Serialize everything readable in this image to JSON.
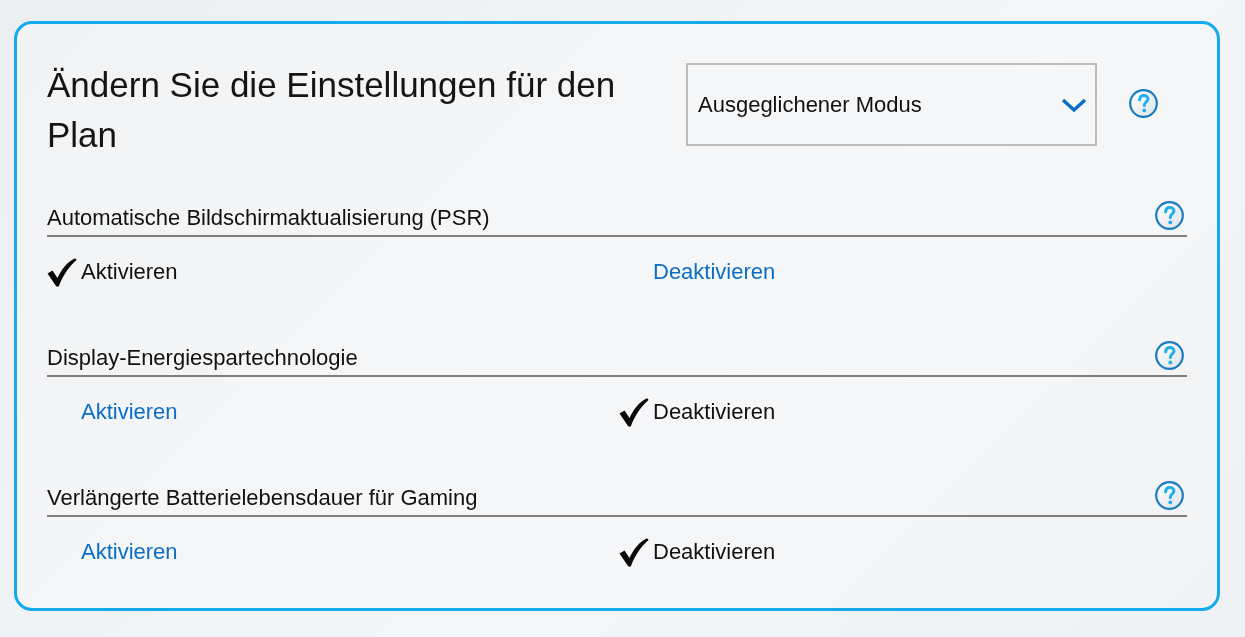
{
  "title": "Ändern Sie die Einstellungen für den Plan",
  "plan_dropdown": {
    "value": "Ausgeglichener Modus"
  },
  "sections": [
    {
      "heading": "Automatische Bildschirmaktualisierung (PSR)",
      "options": [
        {
          "label": "Aktivieren",
          "selected": true
        },
        {
          "label": "Deaktivieren",
          "selected": false
        }
      ]
    },
    {
      "heading": "Display-Energiespartechnologie",
      "options": [
        {
          "label": "Aktivieren",
          "selected": false
        },
        {
          "label": "Deaktivieren",
          "selected": true
        }
      ]
    },
    {
      "heading": "Verlängerte Batterielebensdauer für Gaming",
      "options": [
        {
          "label": "Aktivieren",
          "selected": false
        },
        {
          "label": "Deaktivieren",
          "selected": true
        }
      ]
    }
  ]
}
